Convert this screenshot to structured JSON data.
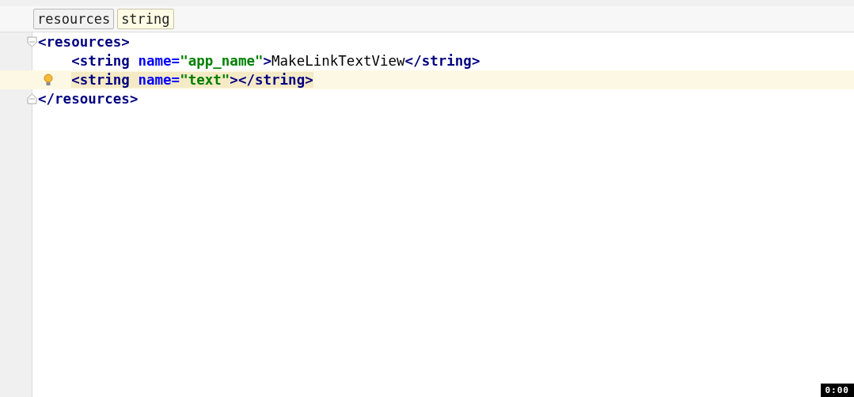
{
  "breadcrumbs": [
    {
      "label": "resources",
      "selected": false
    },
    {
      "label": "string",
      "selected": true
    }
  ],
  "lines": [
    {
      "kind": "open",
      "current": false,
      "matched": false,
      "bulb": false,
      "tokens": [
        {
          "kind": "tag",
          "text": "<resources>"
        }
      ],
      "children": [
        {
          "current": false,
          "matched": false,
          "bulb": false,
          "tokens": [
            {
              "kind": "tag",
              "text": "<string "
            },
            {
              "kind": "attr",
              "text": "name="
            },
            {
              "kind": "value",
              "text": "\"app_name\""
            },
            {
              "kind": "tag",
              "text": ">"
            },
            {
              "kind": "text",
              "text": "MakeLinkTextView"
            },
            {
              "kind": "tag",
              "text": "</string>"
            }
          ]
        },
        {
          "current": true,
          "matched": true,
          "bulb": true,
          "tokens": [
            {
              "kind": "tag",
              "text": "<string "
            },
            {
              "kind": "attr",
              "text": "name="
            },
            {
              "kind": "value",
              "text": "\"text\""
            },
            {
              "kind": "tag",
              "text": "></string>"
            }
          ]
        }
      ]
    },
    {
      "kind": "close",
      "current": false,
      "matched": false,
      "bulb": false,
      "tokens": [
        {
          "kind": "tag",
          "text": "</resources>"
        }
      ]
    }
  ],
  "timer": "0:00"
}
